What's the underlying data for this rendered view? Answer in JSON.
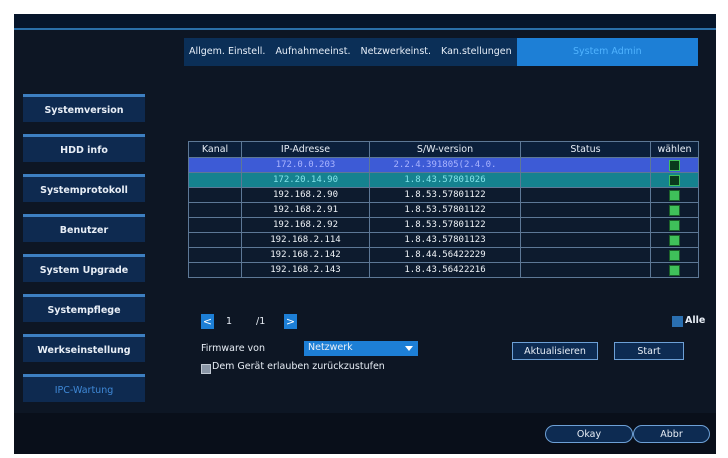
{
  "tabs": [
    {
      "label": "Allgem. Einstell."
    },
    {
      "label": "Aufnahmeeinst."
    },
    {
      "label": "Netzwerkeinst."
    },
    {
      "label": "Kan.stellungen"
    },
    {
      "label": "System Admin"
    }
  ],
  "sidebar": [
    {
      "label": "Systemversion"
    },
    {
      "label": "HDD info"
    },
    {
      "label": "Systemprotokoll"
    },
    {
      "label": "Benutzer"
    },
    {
      "label": "System Upgrade"
    },
    {
      "label": "Systempflege"
    },
    {
      "label": "Werkseinstellung"
    },
    {
      "label": "IPC-Wartung"
    }
  ],
  "table": {
    "headers": [
      "Kanal",
      "IP-Adresse",
      "S/W-version",
      "Status",
      "wählen"
    ],
    "rows": [
      {
        "kanal": "",
        "ip": "172.0.0.203",
        "sw": "2.2.4.391805(2.4.0.",
        "status": "",
        "checked": false
      },
      {
        "kanal": "",
        "ip": "172.20.14.90",
        "sw": "1.8.43.57801026",
        "status": "",
        "checked": false
      },
      {
        "kanal": "",
        "ip": "192.168.2.90",
        "sw": "1.8.53.57801122",
        "status": "",
        "checked": true
      },
      {
        "kanal": "",
        "ip": "192.168.2.91",
        "sw": "1.8.53.57801122",
        "status": "",
        "checked": true
      },
      {
        "kanal": "",
        "ip": "192.168.2.92",
        "sw": "1.8.53.57801122",
        "status": "",
        "checked": true
      },
      {
        "kanal": "",
        "ip": "192.168.2.114",
        "sw": "1.8.43.57801123",
        "status": "",
        "checked": true
      },
      {
        "kanal": "",
        "ip": "192.168.2.142",
        "sw": "1.8.44.56422229",
        "status": "",
        "checked": true
      },
      {
        "kanal": "",
        "ip": "192.168.2.143",
        "sw": "1.8.43.56422216",
        "status": "",
        "checked": true
      }
    ]
  },
  "pager": {
    "prev": "<",
    "current": "1",
    "total": "/1",
    "next": ">"
  },
  "select_all": {
    "label": "Alle"
  },
  "firmware": {
    "label": "Firmware von",
    "value": "Netzwerk"
  },
  "downgrade": {
    "label": "Dem Gerät erlauben zurückzustufen"
  },
  "buttons": {
    "refresh": "Aktualisieren",
    "start": "Start",
    "ok": "Okay",
    "cancel": "Abbr"
  },
  "colors": {
    "accent": "#1d7fd6",
    "background": "#0d1624",
    "row_selected": "#3d5bd6",
    "row_highlight": "#15828f",
    "checkbox": "#3fc15a"
  }
}
